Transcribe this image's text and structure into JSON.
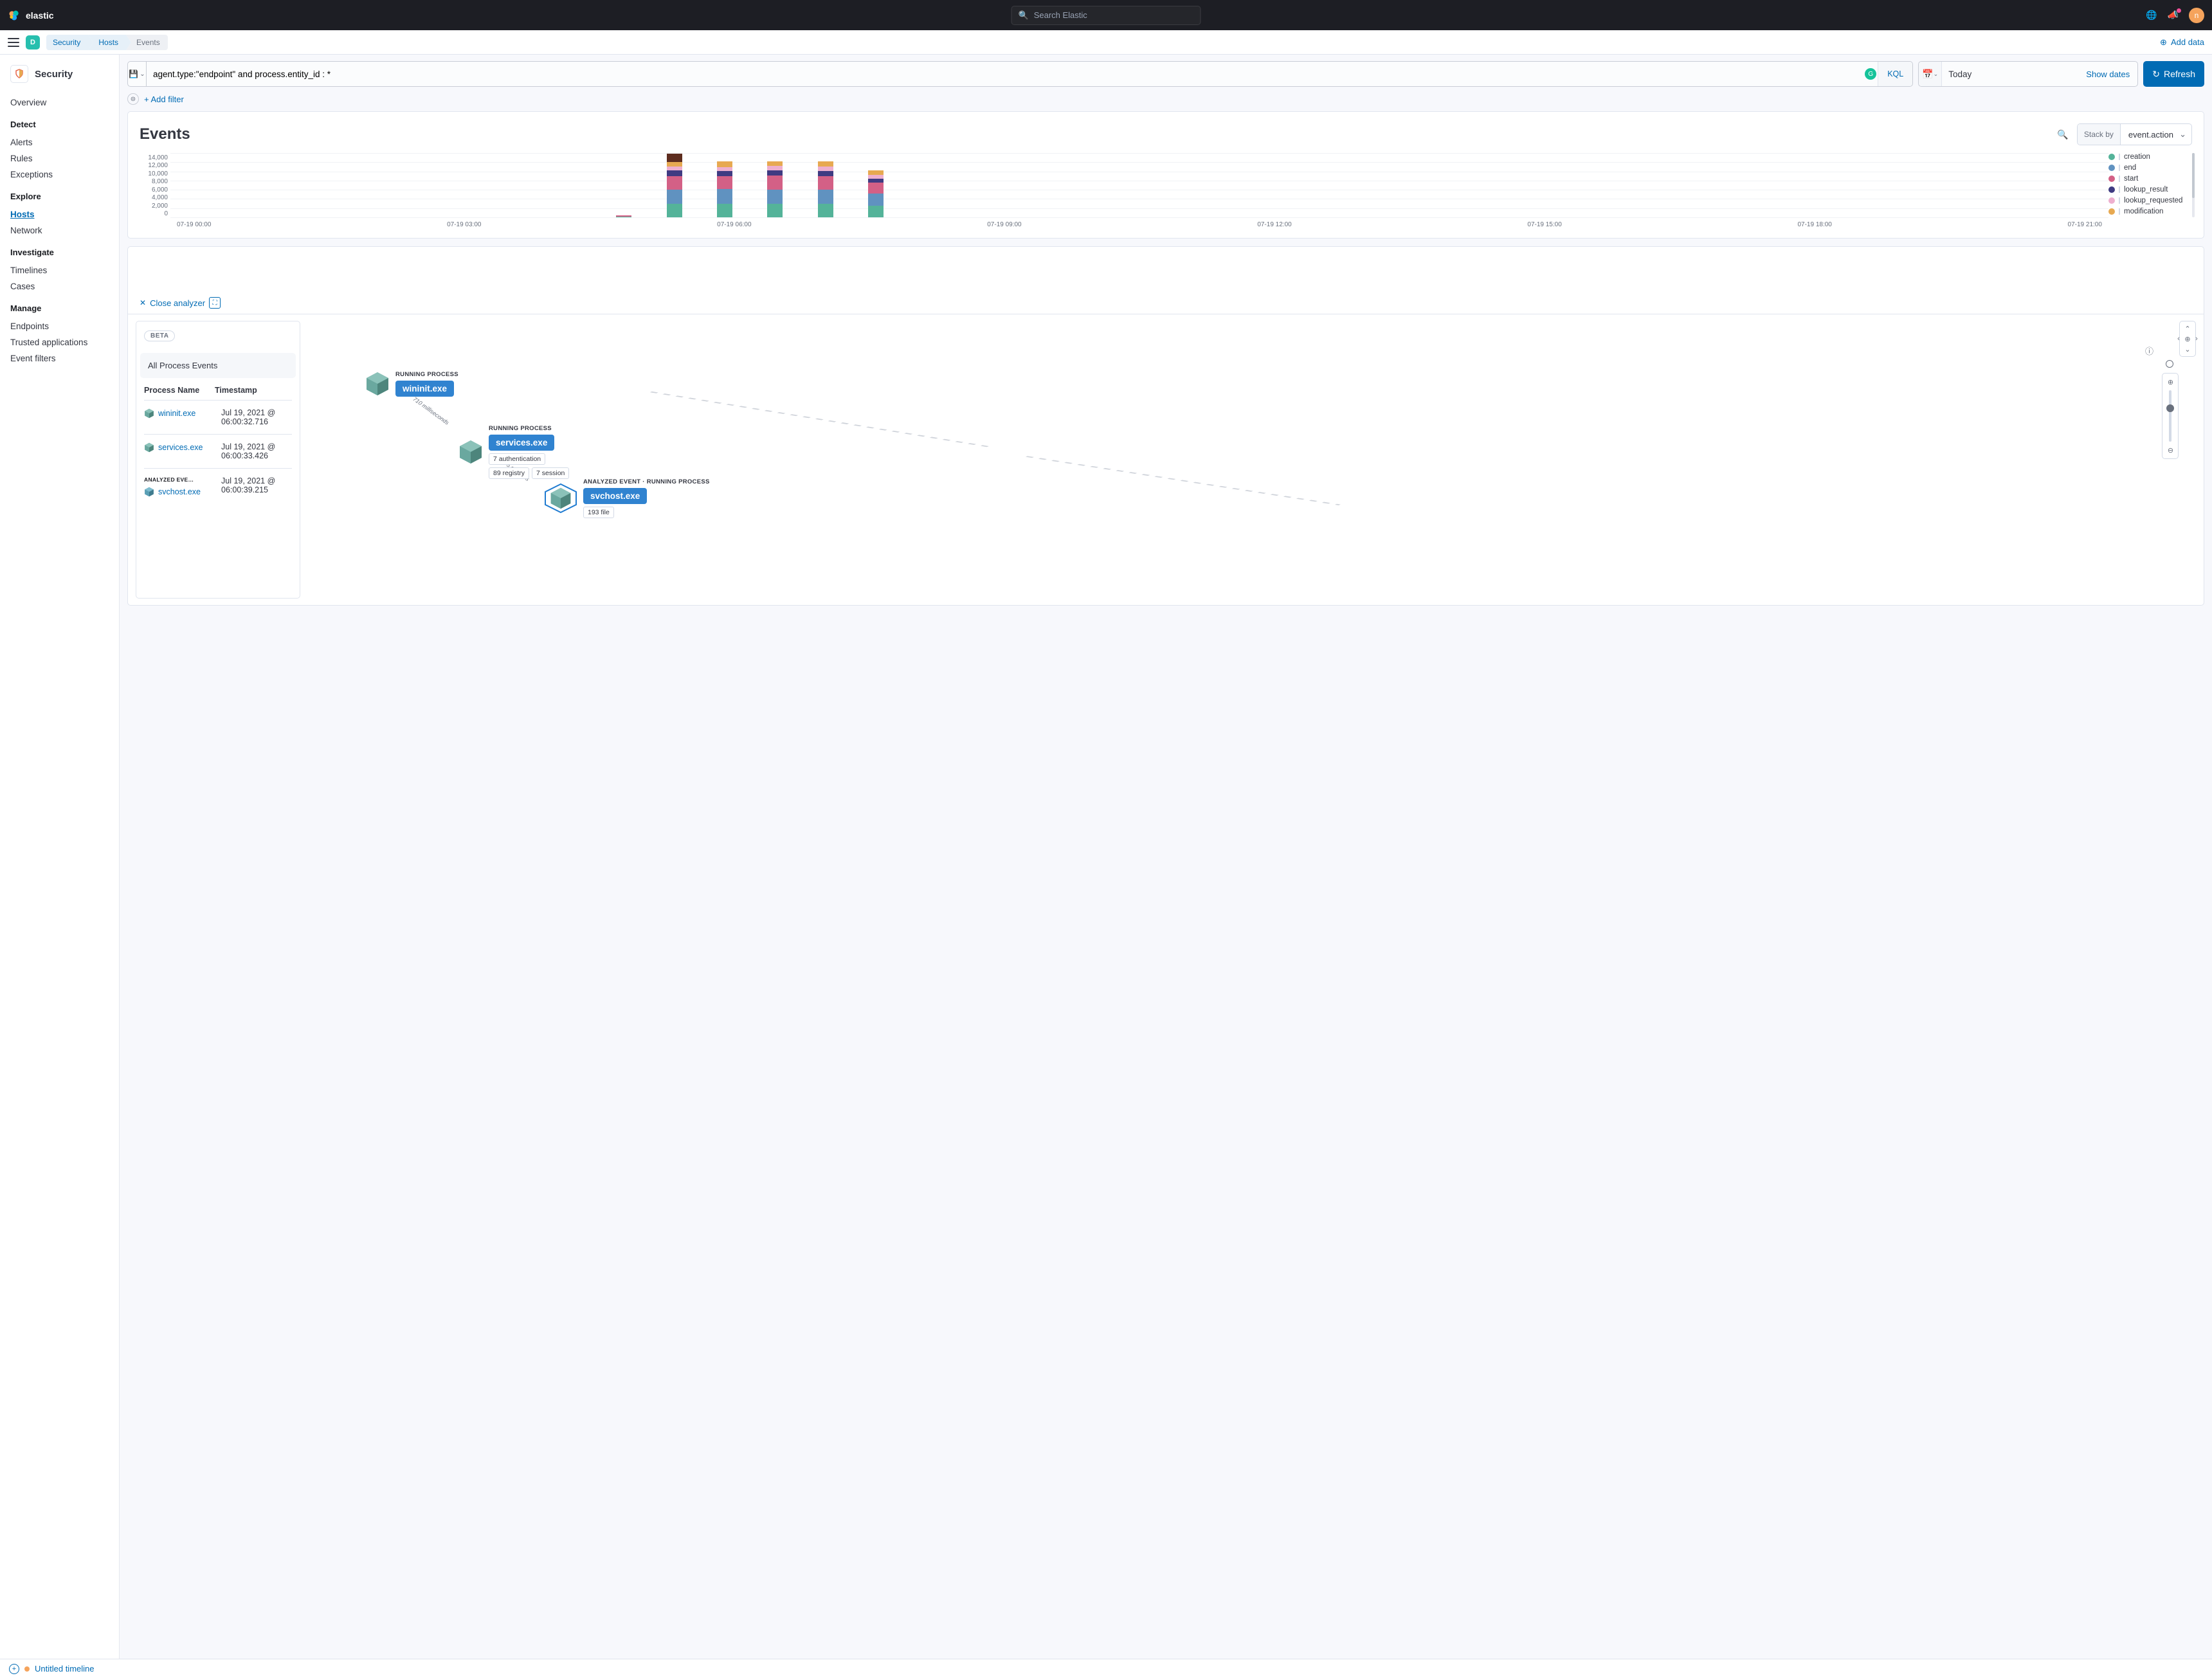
{
  "topbar": {
    "search_placeholder": "Search Elastic",
    "brand": "elastic",
    "avatar_letter": "n"
  },
  "subbar": {
    "space_letter": "D",
    "crumbs": [
      "Security",
      "Hosts",
      "Events"
    ],
    "add_data": "Add data"
  },
  "sidebar": {
    "app": "Security",
    "overview": "Overview",
    "groups": {
      "detect": {
        "title": "Detect",
        "items": [
          "Alerts",
          "Rules",
          "Exceptions"
        ]
      },
      "explore": {
        "title": "Explore",
        "items": [
          "Hosts",
          "Network"
        ],
        "active": "Hosts"
      },
      "investigate": {
        "title": "Investigate",
        "items": [
          "Timelines",
          "Cases"
        ]
      },
      "manage": {
        "title": "Manage",
        "items": [
          "Endpoints",
          "Trusted applications",
          "Event filters"
        ]
      }
    }
  },
  "query": {
    "value": "agent.type:\"endpoint\" and process.entity_id : *",
    "kql": "KQL",
    "today": "Today",
    "show_dates": "Show dates",
    "refresh": "Refresh",
    "add_filter": "+ Add filter"
  },
  "events": {
    "title": "Events",
    "stack_label": "Stack by",
    "stack_value": "event.action",
    "legend": [
      "creation",
      "end",
      "start",
      "lookup_result",
      "lookup_requested",
      "modification"
    ],
    "legend_colors": {
      "creation": "#54b399",
      "end": "#6092c0",
      "start": "#d36086",
      "lookup_result": "#3f3b82",
      "lookup_requested": "#eeafcf",
      "modification": "#e7a951"
    }
  },
  "chart_data": {
    "type": "bar",
    "y_ticks": [
      "14,000",
      "12,000",
      "10,000",
      "8,000",
      "6,000",
      "4,000",
      "2,000",
      "0"
    ],
    "x_ticks": [
      "07-19 00:00",
      "07-19 03:00",
      "07-19 06:00",
      "07-19 09:00",
      "07-19 12:00",
      "07-19 15:00",
      "07-19 18:00",
      "07-19 21:00"
    ],
    "ylim_max": 14000,
    "bars": [
      {
        "pos": 0.23,
        "segs": [
          {
            "c": "#54b399",
            "v": 100
          },
          {
            "c": "#d36086",
            "v": 300
          }
        ]
      },
      {
        "pos": 0.256,
        "segs": [
          {
            "c": "#54b399",
            "v": 3000
          },
          {
            "c": "#6092c0",
            "v": 3200
          },
          {
            "c": "#d36086",
            "v": 3000
          },
          {
            "c": "#3f3b82",
            "v": 1200
          },
          {
            "c": "#eeafcf",
            "v": 900
          },
          {
            "c": "#e7a951",
            "v": 1000
          },
          {
            "c": "#5e2d1f",
            "v": 1800
          }
        ]
      },
      {
        "pos": 0.282,
        "segs": [
          {
            "c": "#54b399",
            "v": 3000
          },
          {
            "c": "#6092c0",
            "v": 3300
          },
          {
            "c": "#d36086",
            "v": 2900
          },
          {
            "c": "#3f3b82",
            "v": 1100
          },
          {
            "c": "#eeafcf",
            "v": 900
          },
          {
            "c": "#e7a951",
            "v": 1200
          }
        ]
      },
      {
        "pos": 0.308,
        "segs": [
          {
            "c": "#54b399",
            "v": 3000
          },
          {
            "c": "#6092c0",
            "v": 3200
          },
          {
            "c": "#d36086",
            "v": 3100
          },
          {
            "c": "#3f3b82",
            "v": 1100
          },
          {
            "c": "#eeafcf",
            "v": 1000
          },
          {
            "c": "#e7a951",
            "v": 1100
          }
        ]
      },
      {
        "pos": 0.334,
        "segs": [
          {
            "c": "#54b399",
            "v": 3000
          },
          {
            "c": "#6092c0",
            "v": 3200
          },
          {
            "c": "#d36086",
            "v": 3000
          },
          {
            "c": "#3f3b82",
            "v": 1100
          },
          {
            "c": "#eeafcf",
            "v": 1000
          },
          {
            "c": "#e7a951",
            "v": 1200
          }
        ]
      },
      {
        "pos": 0.36,
        "segs": [
          {
            "c": "#54b399",
            "v": 2600
          },
          {
            "c": "#6092c0",
            "v": 2700
          },
          {
            "c": "#d36086",
            "v": 2400
          },
          {
            "c": "#3f3b82",
            "v": 900
          },
          {
            "c": "#eeafcf",
            "v": 900
          },
          {
            "c": "#e7a951",
            "v": 900
          }
        ]
      }
    ]
  },
  "analyzer": {
    "close": "Close analyzer",
    "beta": "BETA",
    "all_events": "All Process Events",
    "col1": "Process Name",
    "col2": "Timestamp",
    "rows": [
      {
        "name": "wininit.exe",
        "ts": "Jul 19, 2021 @ 06:00:32.716",
        "analyzed": false
      },
      {
        "name": "services.exe",
        "ts": "Jul 19, 2021 @ 06:00:33.426",
        "analyzed": false
      },
      {
        "name": "svchost.exe",
        "ts": "Jul 19, 2021 @ 06:00:39.215",
        "analyzed": true,
        "tag": "ANALYZED EVE…"
      }
    ],
    "nodes": {
      "n1": {
        "cap": "RUNNING PROCESS",
        "name": "wininit.exe"
      },
      "n2": {
        "cap": "RUNNING PROCESS",
        "name": "services.exe",
        "pills": [
          "7 authentication",
          "89 registry",
          "7 session"
        ]
      },
      "n3": {
        "cap": "ANALYZED EVENT · RUNNING PROCESS",
        "name": "svchost.exe",
        "pills": [
          "193 file"
        ]
      }
    },
    "edges": {
      "e1": "710 milliseconds",
      "e2": "5 seconds"
    }
  },
  "bottombar": {
    "label": "Untitled timeline"
  }
}
